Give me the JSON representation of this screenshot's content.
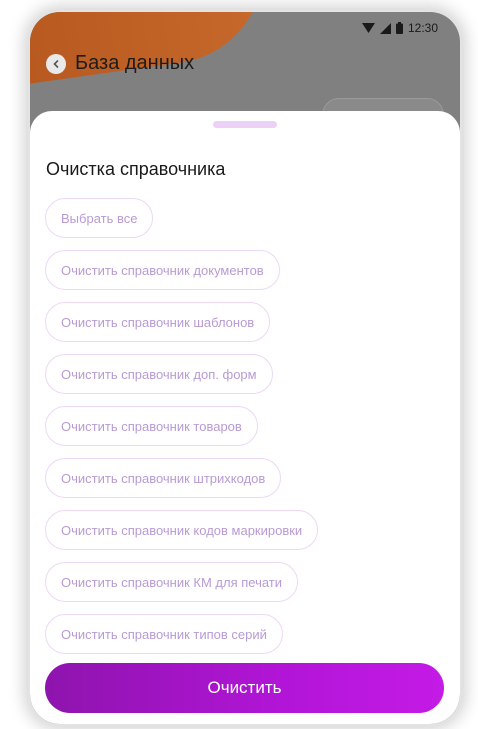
{
  "status_bar": {
    "time": "12:30",
    "icons": [
      "wifi-icon",
      "signal-icon",
      "battery-icon"
    ]
  },
  "header": {
    "title": "База данных",
    "back_icon": "chevron-left-icon"
  },
  "sheet": {
    "title": "Очистка справочника",
    "options": [
      "Выбрать все",
      "Очистить справочник документов",
      "Очистить справочник шаблонов",
      "Очистить справочник доп. форм",
      "Очистить справочник товаров",
      "Очистить справочник штрихкодов",
      "Очистить справочник кодов маркировки",
      "Очистить справочник КМ для печати",
      "Очистить справочник типов серий"
    ],
    "primary_button": "Очистить"
  },
  "colors": {
    "accent_start": "#8e14ad",
    "accent_end": "#c41be6",
    "chip_text": "#b89bd3",
    "chip_border": "#ecd8f4",
    "overlay": "#808080",
    "decor_orange": "#c7692b"
  }
}
